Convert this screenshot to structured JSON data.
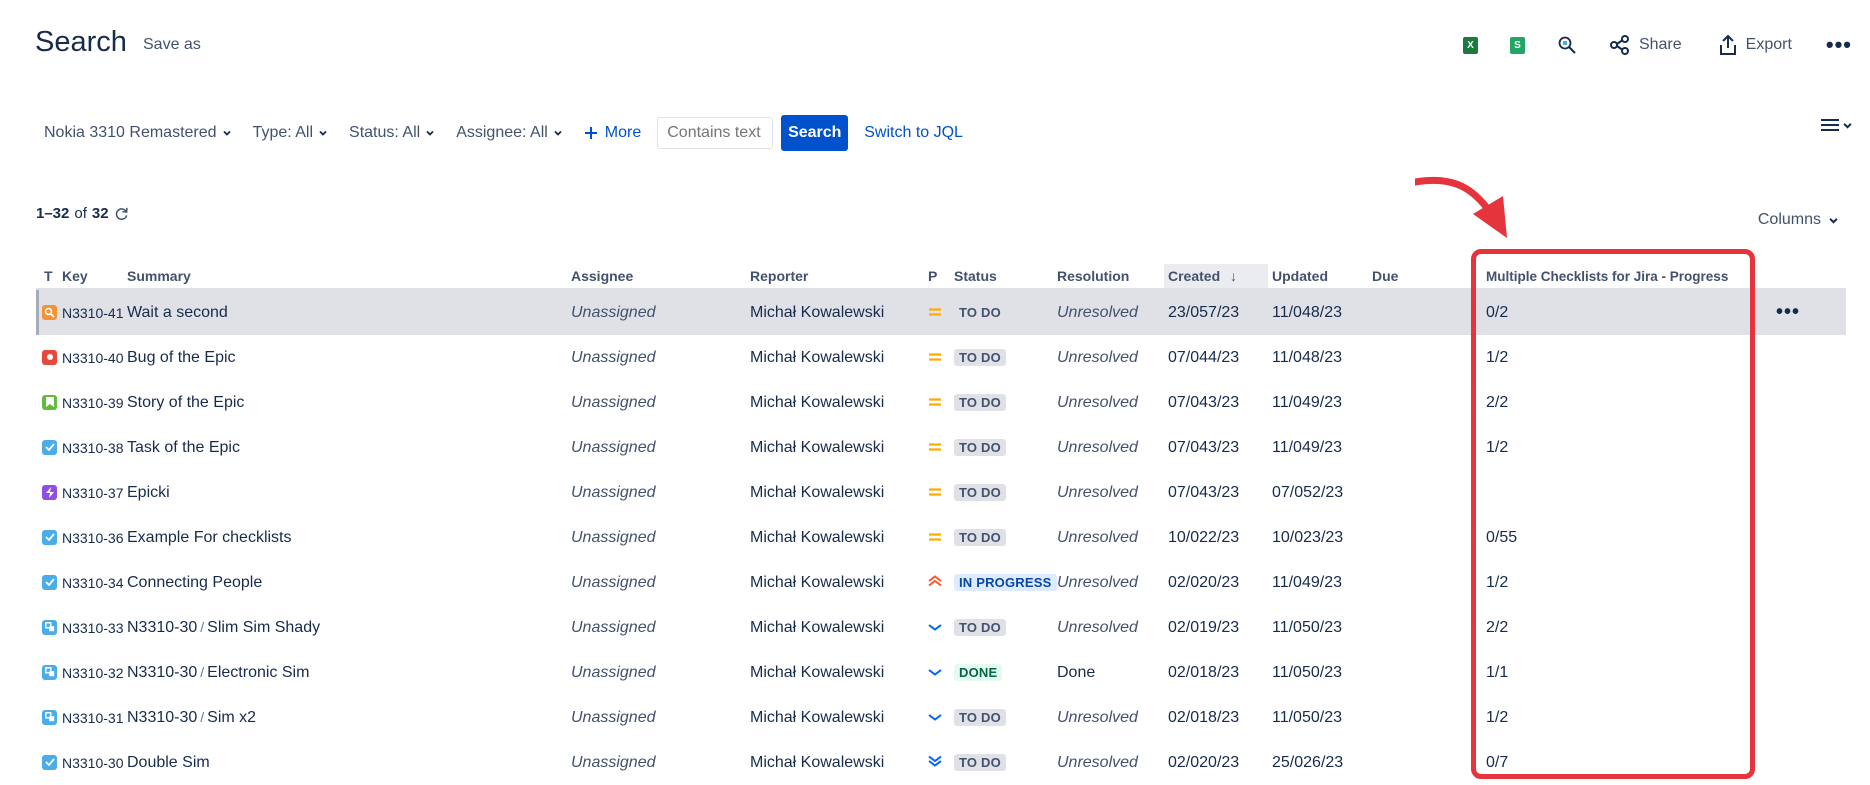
{
  "header": {
    "title": "Search",
    "save_as": "Save as",
    "share": "Share",
    "export": "Export",
    "more_label": "..."
  },
  "filters": {
    "project": "Nokia 3310 Remastered",
    "type": "Type: All",
    "status": "Status: All",
    "assignee": "Assignee: All",
    "more": "More",
    "text_placeholder": "Contains text",
    "search_button": "Search",
    "switch_jql": "Switch to JQL"
  },
  "results": {
    "range": "1–32",
    "of": "of",
    "total": "32",
    "columns_button": "Columns"
  },
  "table": {
    "columns": {
      "type": "T",
      "key": "Key",
      "summary": "Summary",
      "assignee": "Assignee",
      "reporter": "Reporter",
      "priority": "P",
      "status": "Status",
      "resolution": "Resolution",
      "created": "Created",
      "updated": "Updated",
      "due": "Due",
      "checklist": "Multiple Checklists for Jira - Progress"
    },
    "rows": [
      {
        "key": "N3310-41",
        "summary": "Wait a second",
        "parent": "",
        "assignee": "Unassigned",
        "reporter": "Michał Kowalewski",
        "status": "TO DO",
        "resolution": "Unresolved",
        "created": "23/057/23",
        "updated": "11/048/23",
        "due": "",
        "progress": "0/2"
      },
      {
        "key": "N3310-40",
        "summary": "Bug of the Epic",
        "parent": "",
        "assignee": "Unassigned",
        "reporter": "Michał Kowalewski",
        "status": "TO DO",
        "resolution": "Unresolved",
        "created": "07/044/23",
        "updated": "11/048/23",
        "due": "",
        "progress": "1/2"
      },
      {
        "key": "N3310-39",
        "summary": "Story of the Epic",
        "parent": "",
        "assignee": "Unassigned",
        "reporter": "Michał Kowalewski",
        "status": "TO DO",
        "resolution": "Unresolved",
        "created": "07/043/23",
        "updated": "11/049/23",
        "due": "",
        "progress": "2/2"
      },
      {
        "key": "N3310-38",
        "summary": "Task of the Epic",
        "parent": "",
        "assignee": "Unassigned",
        "reporter": "Michał Kowalewski",
        "status": "TO DO",
        "resolution": "Unresolved",
        "created": "07/043/23",
        "updated": "11/049/23",
        "due": "",
        "progress": "1/2"
      },
      {
        "key": "N3310-37",
        "summary": "Epicki",
        "parent": "",
        "assignee": "Unassigned",
        "reporter": "Michał Kowalewski",
        "status": "TO DO",
        "resolution": "Unresolved",
        "created": "07/043/23",
        "updated": "07/052/23",
        "due": "",
        "progress": ""
      },
      {
        "key": "N3310-36",
        "summary": "Example For checklists",
        "parent": "",
        "assignee": "Unassigned",
        "reporter": "Michał Kowalewski",
        "status": "TO DO",
        "resolution": "Unresolved",
        "created": "10/022/23",
        "updated": "10/023/23",
        "due": "",
        "progress": "0/55"
      },
      {
        "key": "N3310-34",
        "summary": "Connecting People",
        "parent": "",
        "assignee": "Unassigned",
        "reporter": "Michał Kowalewski",
        "status": "IN PROGRESS",
        "resolution": "Unresolved",
        "created": "02/020/23",
        "updated": "11/049/23",
        "due": "",
        "progress": "1/2"
      },
      {
        "key": "N3310-33",
        "summary": "Slim Sim Shady",
        "parent": "N3310-30",
        "assignee": "Unassigned",
        "reporter": "Michał Kowalewski",
        "status": "TO DO",
        "resolution": "Unresolved",
        "created": "02/019/23",
        "updated": "11/050/23",
        "due": "",
        "progress": "2/2"
      },
      {
        "key": "N3310-32",
        "summary": "Electronic Sim",
        "parent": "N3310-30",
        "assignee": "Unassigned",
        "reporter": "Michał Kowalewski",
        "status": "DONE",
        "resolution": "Done",
        "created": "02/018/23",
        "updated": "11/050/23",
        "due": "",
        "progress": "1/1"
      },
      {
        "key": "N3310-31",
        "summary": "Sim x2",
        "parent": "N3310-30",
        "assignee": "Unassigned",
        "reporter": "Michał Kowalewski",
        "status": "TO DO",
        "resolution": "Unresolved",
        "created": "02/018/23",
        "updated": "11/050/23",
        "due": "",
        "progress": "1/2"
      },
      {
        "key": "N3310-30",
        "summary": "Double Sim",
        "parent": "",
        "assignee": "Unassigned",
        "reporter": "Michał Kowalewski",
        "status": "TO DO",
        "resolution": "Unresolved",
        "created": "02/020/23",
        "updated": "25/026/23",
        "due": "",
        "progress": "0/7"
      }
    ],
    "row_icons": [
      {
        "type": "search-issue-icon",
        "priority": "medium-priority-icon"
      },
      {
        "type": "bug-icon",
        "priority": "medium-priority-icon"
      },
      {
        "type": "story-icon",
        "priority": "medium-priority-icon"
      },
      {
        "type": "task-icon",
        "priority": "medium-priority-icon"
      },
      {
        "type": "epic-icon",
        "priority": "medium-priority-icon"
      },
      {
        "type": "task-icon",
        "priority": "medium-priority-icon"
      },
      {
        "type": "task-icon",
        "priority": "high-priority-icon"
      },
      {
        "type": "subtask-icon",
        "priority": "low-priority-icon"
      },
      {
        "type": "subtask-icon",
        "priority": "low-priority-icon"
      },
      {
        "type": "subtask-icon",
        "priority": "low-priority-icon"
      },
      {
        "type": "task-icon",
        "priority": "lowest-priority-icon"
      }
    ],
    "row_menu": "•••"
  },
  "colors": {
    "accent": "#0052cc",
    "annotation": "#e5343b",
    "bug": "#e5493a",
    "story": "#63ba3c",
    "task": "#4bade8",
    "epic": "#904ee2",
    "search": "#f79232",
    "priority_medium": "#ffab00",
    "priority_high": "#ff5630",
    "priority_low": "#0065ff"
  }
}
